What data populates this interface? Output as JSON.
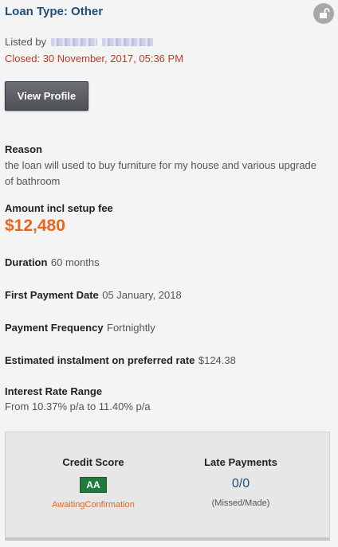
{
  "header": {
    "title": "Loan Type: Other",
    "lock_icon": "unlock-icon"
  },
  "listing": {
    "listed_by_label": "Listed by",
    "closed_text": "Closed: 30 November, 2017, 05:36 PM"
  },
  "actions": {
    "view_profile_label": "View Profile"
  },
  "details": {
    "reason_label": "Reason",
    "reason_text": "the loan will used to buy furniture for my house and various upgrade of bathroom",
    "amount_label": "Amount incl setup fee",
    "amount_value": "$12,480",
    "duration_label": "Duration",
    "duration_value": "60 months",
    "first_payment_label": "First Payment Date",
    "first_payment_value": "05 January, 2018",
    "frequency_label": "Payment Frequency",
    "frequency_value": "Fortnightly",
    "instalment_label": "Estimated instalment on preferred rate",
    "instalment_value": "$124.38",
    "rate_label": "Interest Rate Range",
    "rate_value": "From 10.37% p/a to 11.40% p/a"
  },
  "summary": {
    "credit_score_label": "Credit Score",
    "credit_score_value": "AA",
    "credit_status": "AwaitingConfirmation",
    "late_payments_label": "Late Payments",
    "late_payments_value": "0/0",
    "late_payments_sub": "(Missed/Made)"
  },
  "colors": {
    "title": "#1f4e79",
    "closed": "#c0392b",
    "amount": "#e8651e",
    "badge": "#1f7a3b"
  }
}
